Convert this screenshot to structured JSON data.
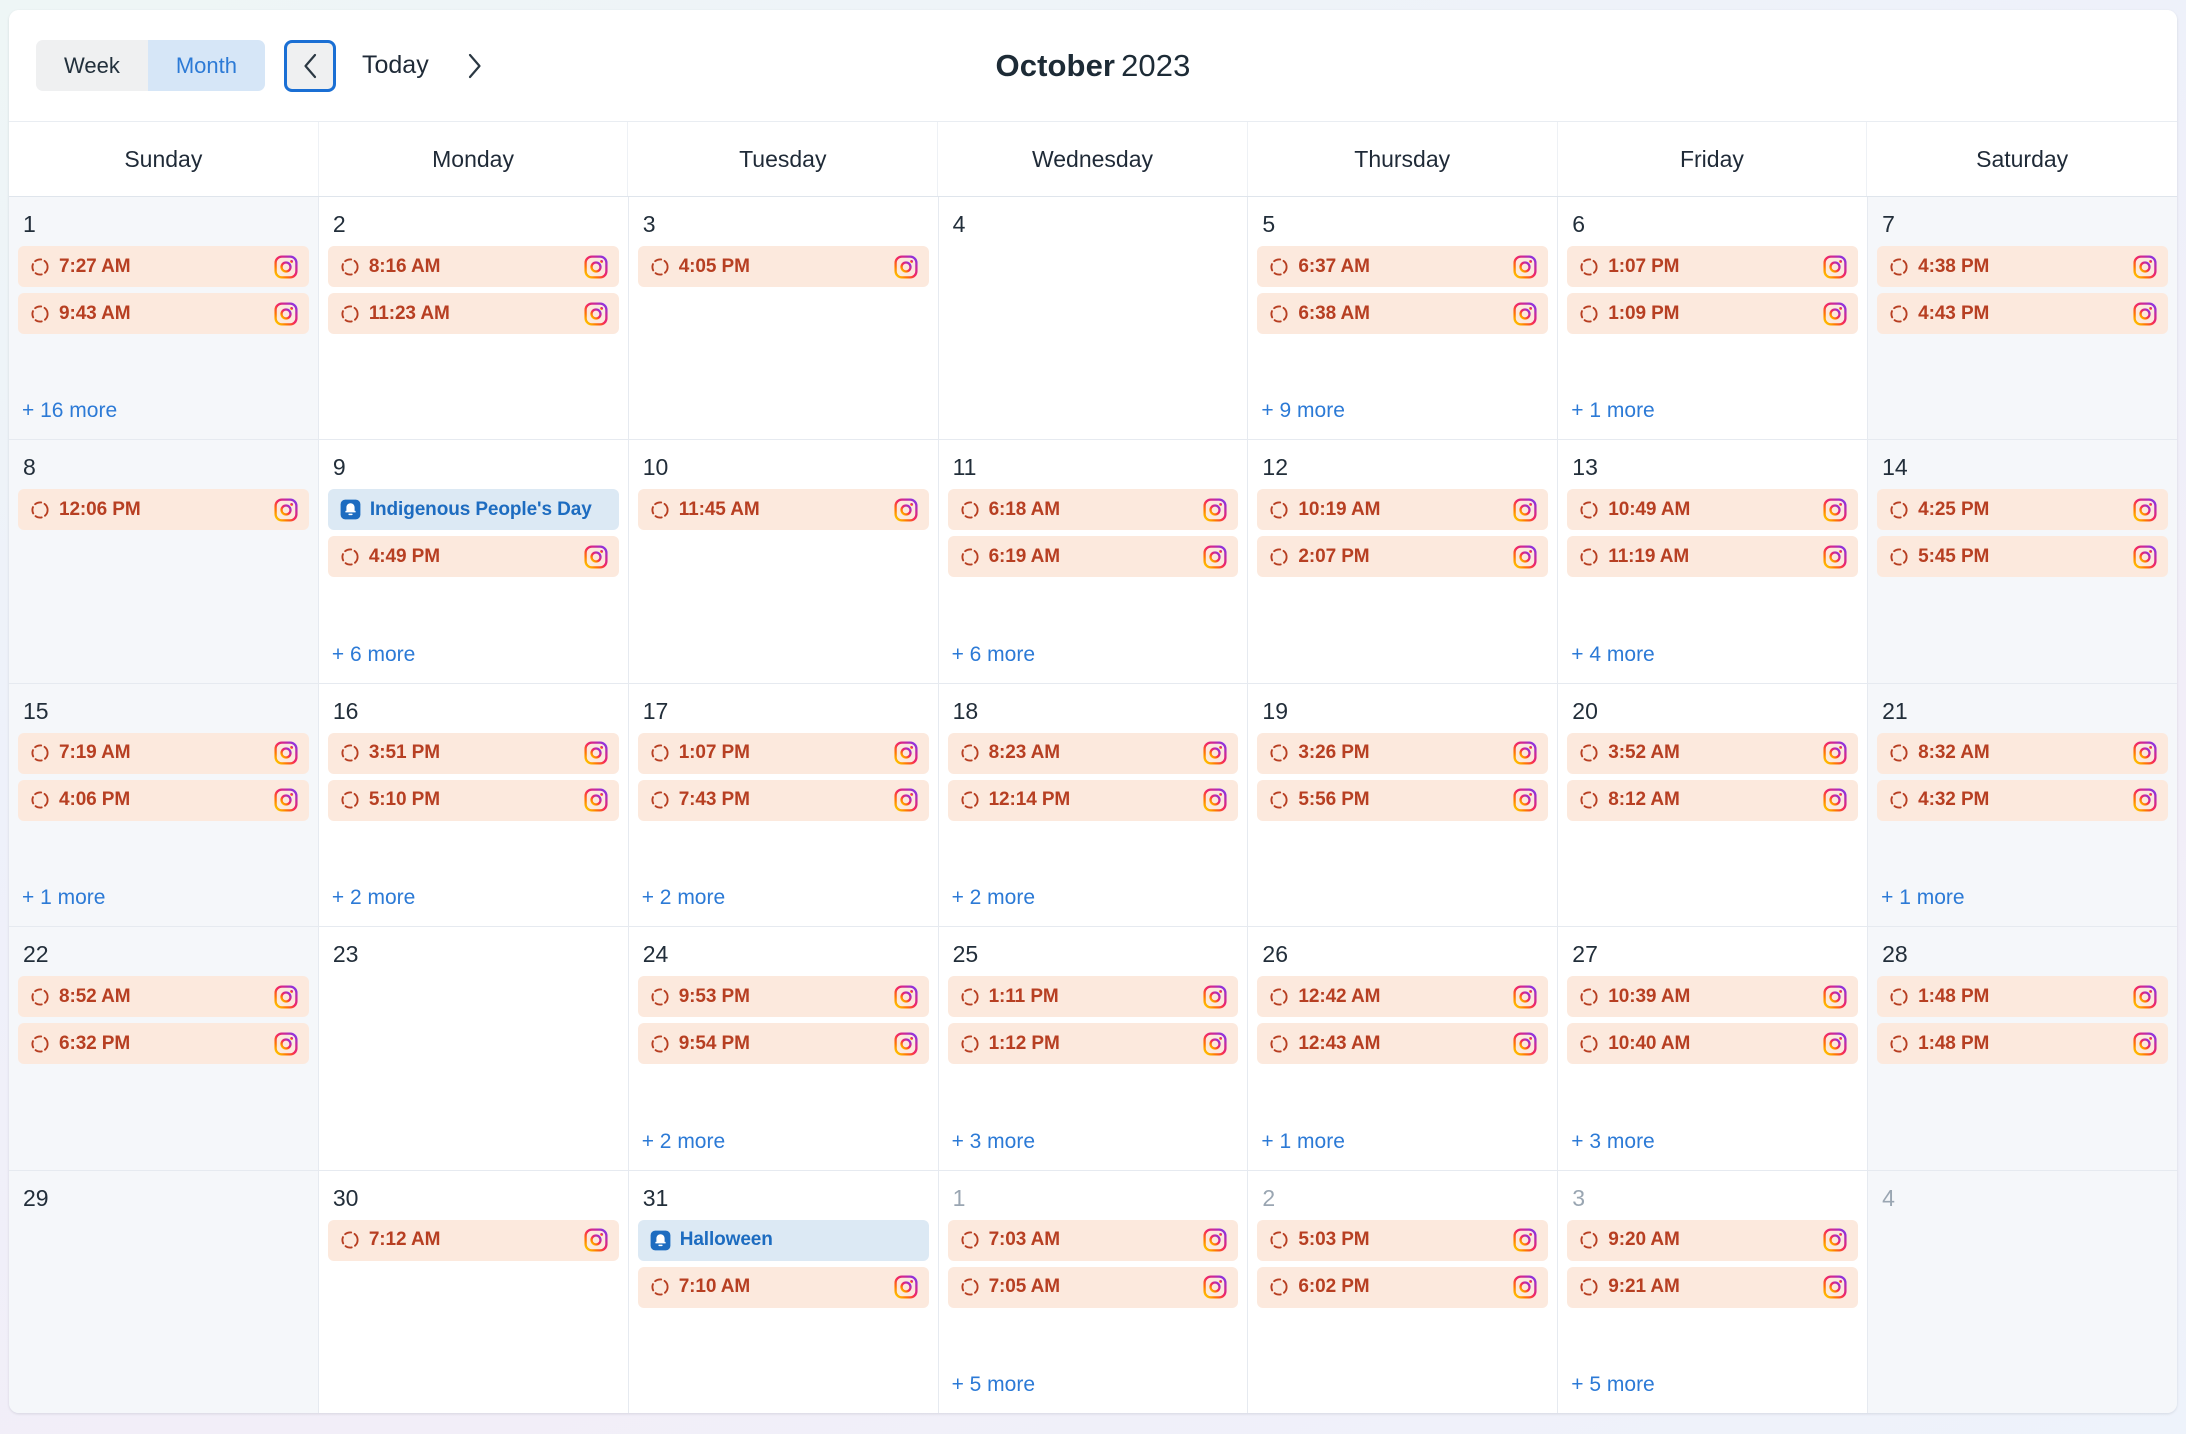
{
  "toolbar": {
    "week_label": "Week",
    "month_label": "Month",
    "prev_icon": "chevron-left-icon",
    "today_label": "Today",
    "next_icon": "chevron-right-icon"
  },
  "header": {
    "month_name": "October",
    "year": "2023"
  },
  "weekdays": [
    "Sunday",
    "Monday",
    "Tuesday",
    "Wednesday",
    "Thursday",
    "Friday",
    "Saturday"
  ],
  "colors": {
    "post_bg": "#fce9dd",
    "post_text": "#b73f22",
    "holiday_bg": "#dce9f4",
    "holiday_text": "#1d6cc0",
    "link": "#2c7ad6",
    "active_tab_bg": "#d6e6f7",
    "active_tab_text": "#2c7ad6",
    "weekend_bg": "#f5f7fa",
    "focus_ring": "#1a6fd4"
  },
  "icons": {
    "post_status": "dashed-circle-icon",
    "post_channel": "instagram-icon",
    "holiday": "holiday-badge-icon"
  },
  "weeks": [
    [
      {
        "day": "1",
        "other_month": false,
        "weekend": true,
        "events": [
          {
            "type": "post",
            "label": "7:27 AM"
          },
          {
            "type": "post",
            "label": "9:43 AM"
          }
        ],
        "more": "+ 16 more"
      },
      {
        "day": "2",
        "other_month": false,
        "weekend": false,
        "events": [
          {
            "type": "post",
            "label": "8:16 AM"
          },
          {
            "type": "post",
            "label": "11:23 AM"
          }
        ],
        "more": ""
      },
      {
        "day": "3",
        "other_month": false,
        "weekend": false,
        "events": [
          {
            "type": "post",
            "label": "4:05 PM"
          }
        ],
        "more": ""
      },
      {
        "day": "4",
        "other_month": false,
        "weekend": false,
        "events": [],
        "more": ""
      },
      {
        "day": "5",
        "other_month": false,
        "weekend": false,
        "events": [
          {
            "type": "post",
            "label": "6:37 AM"
          },
          {
            "type": "post",
            "label": "6:38 AM"
          }
        ],
        "more": "+ 9 more"
      },
      {
        "day": "6",
        "other_month": false,
        "weekend": false,
        "events": [
          {
            "type": "post",
            "label": "1:07 PM"
          },
          {
            "type": "post",
            "label": "1:09 PM"
          }
        ],
        "more": "+ 1 more"
      },
      {
        "day": "7",
        "other_month": false,
        "weekend": true,
        "events": [
          {
            "type": "post",
            "label": "4:38 PM"
          },
          {
            "type": "post",
            "label": "4:43 PM"
          }
        ],
        "more": ""
      }
    ],
    [
      {
        "day": "8",
        "other_month": false,
        "weekend": true,
        "events": [
          {
            "type": "post",
            "label": "12:06 PM"
          }
        ],
        "more": ""
      },
      {
        "day": "9",
        "other_month": false,
        "weekend": false,
        "events": [
          {
            "type": "holiday",
            "label": "Indigenous People's Day"
          },
          {
            "type": "post",
            "label": "4:49 PM"
          }
        ],
        "more": "+ 6 more"
      },
      {
        "day": "10",
        "other_month": false,
        "weekend": false,
        "events": [
          {
            "type": "post",
            "label": "11:45 AM"
          }
        ],
        "more": ""
      },
      {
        "day": "11",
        "other_month": false,
        "weekend": false,
        "events": [
          {
            "type": "post",
            "label": "6:18 AM"
          },
          {
            "type": "post",
            "label": "6:19 AM"
          }
        ],
        "more": "+ 6 more"
      },
      {
        "day": "12",
        "other_month": false,
        "weekend": false,
        "events": [
          {
            "type": "post",
            "label": "10:19 AM"
          },
          {
            "type": "post",
            "label": "2:07 PM"
          }
        ],
        "more": ""
      },
      {
        "day": "13",
        "other_month": false,
        "weekend": false,
        "events": [
          {
            "type": "post",
            "label": "10:49 AM"
          },
          {
            "type": "post",
            "label": "11:19 AM"
          }
        ],
        "more": "+ 4 more"
      },
      {
        "day": "14",
        "other_month": false,
        "weekend": true,
        "events": [
          {
            "type": "post",
            "label": "4:25 PM"
          },
          {
            "type": "post",
            "label": "5:45 PM"
          }
        ],
        "more": ""
      }
    ],
    [
      {
        "day": "15",
        "other_month": false,
        "weekend": true,
        "events": [
          {
            "type": "post",
            "label": "7:19 AM"
          },
          {
            "type": "post",
            "label": "4:06 PM"
          }
        ],
        "more": "+ 1 more"
      },
      {
        "day": "16",
        "other_month": false,
        "weekend": false,
        "events": [
          {
            "type": "post",
            "label": "3:51 PM"
          },
          {
            "type": "post",
            "label": "5:10 PM"
          }
        ],
        "more": "+ 2 more"
      },
      {
        "day": "17",
        "other_month": false,
        "weekend": false,
        "events": [
          {
            "type": "post",
            "label": "1:07 PM"
          },
          {
            "type": "post",
            "label": "7:43 PM"
          }
        ],
        "more": "+ 2 more"
      },
      {
        "day": "18",
        "other_month": false,
        "weekend": false,
        "events": [
          {
            "type": "post",
            "label": "8:23 AM"
          },
          {
            "type": "post",
            "label": "12:14 PM"
          }
        ],
        "more": "+ 2 more"
      },
      {
        "day": "19",
        "other_month": false,
        "weekend": false,
        "events": [
          {
            "type": "post",
            "label": "3:26 PM"
          },
          {
            "type": "post",
            "label": "5:56 PM"
          }
        ],
        "more": ""
      },
      {
        "day": "20",
        "other_month": false,
        "weekend": false,
        "events": [
          {
            "type": "post",
            "label": "3:52 AM"
          },
          {
            "type": "post",
            "label": "8:12 AM"
          }
        ],
        "more": ""
      },
      {
        "day": "21",
        "other_month": false,
        "weekend": true,
        "events": [
          {
            "type": "post",
            "label": "8:32 AM"
          },
          {
            "type": "post",
            "label": "4:32 PM"
          }
        ],
        "more": "+ 1 more"
      }
    ],
    [
      {
        "day": "22",
        "other_month": false,
        "weekend": true,
        "events": [
          {
            "type": "post",
            "label": "8:52 AM"
          },
          {
            "type": "post",
            "label": "6:32 PM"
          }
        ],
        "more": ""
      },
      {
        "day": "23",
        "other_month": false,
        "weekend": false,
        "events": [],
        "more": ""
      },
      {
        "day": "24",
        "other_month": false,
        "weekend": false,
        "events": [
          {
            "type": "post",
            "label": "9:53 PM"
          },
          {
            "type": "post",
            "label": "9:54 PM"
          }
        ],
        "more": "+ 2 more"
      },
      {
        "day": "25",
        "other_month": false,
        "weekend": false,
        "events": [
          {
            "type": "post",
            "label": "1:11 PM"
          },
          {
            "type": "post",
            "label": "1:12 PM"
          }
        ],
        "more": "+ 3 more"
      },
      {
        "day": "26",
        "other_month": false,
        "weekend": false,
        "events": [
          {
            "type": "post",
            "label": "12:42 AM"
          },
          {
            "type": "post",
            "label": "12:43 AM"
          }
        ],
        "more": "+ 1 more"
      },
      {
        "day": "27",
        "other_month": false,
        "weekend": false,
        "events": [
          {
            "type": "post",
            "label": "10:39 AM"
          },
          {
            "type": "post",
            "label": "10:40 AM"
          }
        ],
        "more": "+ 3 more"
      },
      {
        "day": "28",
        "other_month": false,
        "weekend": true,
        "events": [
          {
            "type": "post",
            "label": "1:48 PM"
          },
          {
            "type": "post",
            "label": "1:48 PM"
          }
        ],
        "more": ""
      }
    ],
    [
      {
        "day": "29",
        "other_month": false,
        "weekend": true,
        "events": [],
        "more": ""
      },
      {
        "day": "30",
        "other_month": false,
        "weekend": false,
        "events": [
          {
            "type": "post",
            "label": "7:12 AM"
          }
        ],
        "more": ""
      },
      {
        "day": "31",
        "other_month": false,
        "weekend": false,
        "events": [
          {
            "type": "holiday",
            "label": "Halloween"
          },
          {
            "type": "post",
            "label": "7:10 AM"
          }
        ],
        "more": ""
      },
      {
        "day": "1",
        "other_month": true,
        "weekend": false,
        "events": [
          {
            "type": "post",
            "label": "7:03 AM"
          },
          {
            "type": "post",
            "label": "7:05 AM"
          }
        ],
        "more": "+ 5 more"
      },
      {
        "day": "2",
        "other_month": true,
        "weekend": false,
        "events": [
          {
            "type": "post",
            "label": "5:03 PM"
          },
          {
            "type": "post",
            "label": "6:02 PM"
          }
        ],
        "more": ""
      },
      {
        "day": "3",
        "other_month": true,
        "weekend": false,
        "events": [
          {
            "type": "post",
            "label": "9:20 AM"
          },
          {
            "type": "post",
            "label": "9:21 AM"
          }
        ],
        "more": "+ 5 more"
      },
      {
        "day": "4",
        "other_month": true,
        "weekend": true,
        "events": [],
        "more": ""
      }
    ]
  ]
}
